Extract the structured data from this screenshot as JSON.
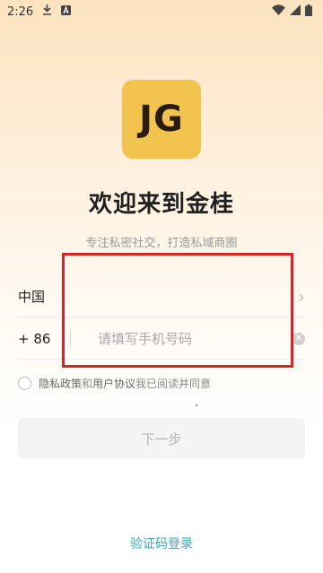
{
  "status_bar": {
    "time": "2:26"
  },
  "logo": {
    "text": "JG"
  },
  "title": "欢迎来到金桂",
  "subtitle": "专注私密社交，打造私域商圈",
  "country": {
    "label": "中国"
  },
  "phone": {
    "code": "+ 86",
    "placeholder": "请填写手机号码",
    "value": ""
  },
  "agreement": {
    "privacy_policy": "隐私政策",
    "and": " 和 ",
    "user_agreement": "用户协议",
    "suffix": "我已阅读并同意"
  },
  "next_button": "下一步",
  "sms_login": "验证码登录",
  "colors": {
    "logo_bg": "#f2c34e",
    "highlight_box": "#d9232a",
    "link": "#3fa6b8"
  }
}
